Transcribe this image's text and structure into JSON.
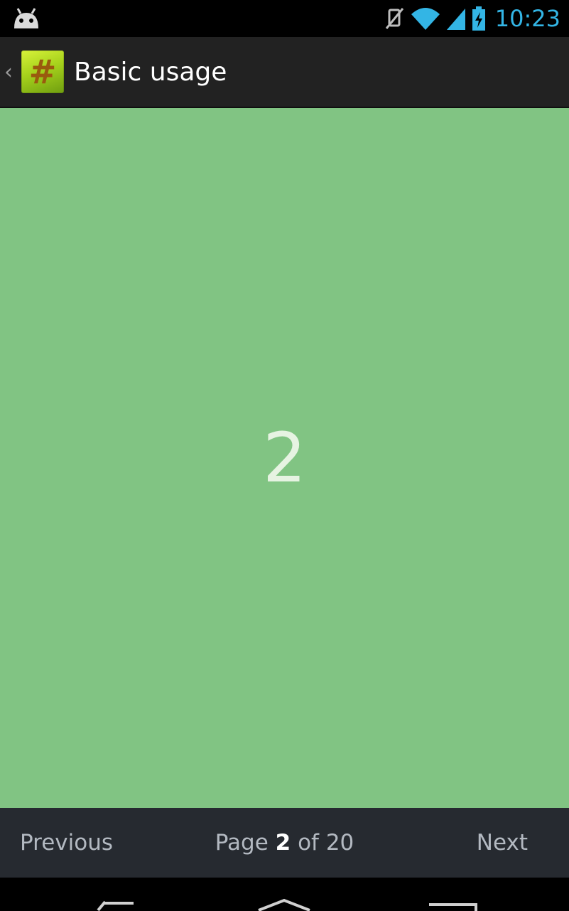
{
  "status_bar": {
    "time": "10:23",
    "icons": [
      "android-debug-icon",
      "muted-vibrate-icon",
      "wifi-icon",
      "cell-signal-icon",
      "battery-charging-icon"
    ],
    "accent_color": "#33b5e5"
  },
  "action_bar": {
    "title": "Basic usage",
    "up_glyph": "‹",
    "app_icon_glyph": "#"
  },
  "content": {
    "page_number": "2",
    "background_color": "#81c483"
  },
  "pager": {
    "previous_label": "Previous",
    "next_label": "Next",
    "page_prefix": "Page",
    "current_page": "2",
    "of_label": "of",
    "total_pages": "20"
  },
  "nav_bar": {
    "icons": [
      "back-icon",
      "home-icon",
      "recent-apps-icon"
    ]
  }
}
